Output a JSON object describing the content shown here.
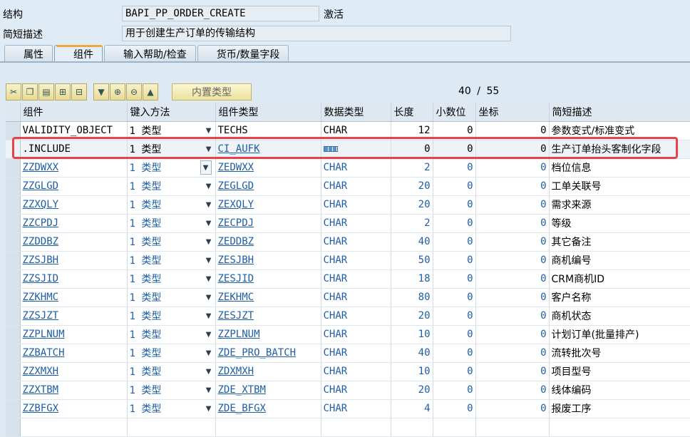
{
  "header": {
    "structure_label": "结构",
    "structure_value": "BAPI_PP_ORDER_CREATE",
    "status": "激活",
    "short_desc_label": "简短描述",
    "short_desc_value": "用于创建生产订单的传输结构"
  },
  "tabs": [
    {
      "label": "属性",
      "active": false
    },
    {
      "label": "组件",
      "active": true
    },
    {
      "label": "输入帮助/检查",
      "active": false
    },
    {
      "label": "货币/数量字段",
      "active": false
    }
  ],
  "toolbar": {
    "builtin_type_label": "内置类型",
    "counter_current": "40",
    "counter_sep": "/",
    "counter_total": "55",
    "icons": [
      "cut-icon",
      "copy-icon",
      "paste-icon",
      "insert-row-icon",
      "delete-row-icon",
      "filter-icon",
      "expand-icon",
      "collapse-icon",
      "sort-icon"
    ]
  },
  "columns": [
    "组件",
    "键入方法",
    "组件类型",
    "数据类型",
    "长度",
    "小数位",
    "坐标",
    "简短描述"
  ],
  "rows": [
    {
      "component": "VALIDITY_OBJECT",
      "method_num": "1",
      "method": "类型",
      "comp_type": "TECHS",
      "data_type": "CHAR",
      "length": "12",
      "decimals": "0",
      "coord": "0",
      "desc": "参数变式/标准变式",
      "link": false,
      "active": false
    },
    {
      "component": ".INCLUDE",
      "method_num": "1",
      "method": "类型",
      "comp_type": "CI_AUFK",
      "data_type": "",
      "length": "0",
      "decimals": "0",
      "coord": "0",
      "desc": "生产订单抬头客制化字段",
      "link": false,
      "active": true
    },
    {
      "component": "ZZDWXX",
      "method_num": "1",
      "method": "类型",
      "comp_type": "ZEDWXX",
      "data_type": "CHAR",
      "length": "2",
      "decimals": "0",
      "coord": "0",
      "desc": "档位信息",
      "link": true,
      "active": false
    },
    {
      "component": "ZZGLGD",
      "method_num": "1",
      "method": "类型",
      "comp_type": "ZEGLGD",
      "data_type": "CHAR",
      "length": "20",
      "decimals": "0",
      "coord": "0",
      "desc": "工单关联号",
      "link": true,
      "active": false
    },
    {
      "component": "ZZXQLY",
      "method_num": "1",
      "method": "类型",
      "comp_type": "ZEXQLY",
      "data_type": "CHAR",
      "length": "20",
      "decimals": "0",
      "coord": "0",
      "desc": "需求来源",
      "link": true,
      "active": false
    },
    {
      "component": "ZZCPDJ",
      "method_num": "1",
      "method": "类型",
      "comp_type": "ZECPDJ",
      "data_type": "CHAR",
      "length": "2",
      "decimals": "0",
      "coord": "0",
      "desc": "等级",
      "link": true,
      "active": false
    },
    {
      "component": "ZZDDBZ",
      "method_num": "1",
      "method": "类型",
      "comp_type": "ZEDDBZ",
      "data_type": "CHAR",
      "length": "40",
      "decimals": "0",
      "coord": "0",
      "desc": "其它备注",
      "link": true,
      "active": false
    },
    {
      "component": "ZZSJBH",
      "method_num": "1",
      "method": "类型",
      "comp_type": "ZESJBH",
      "data_type": "CHAR",
      "length": "50",
      "decimals": "0",
      "coord": "0",
      "desc": "商机编号",
      "link": true,
      "active": false
    },
    {
      "component": "ZZSJID",
      "method_num": "1",
      "method": "类型",
      "comp_type": "ZESJID",
      "data_type": "CHAR",
      "length": "18",
      "decimals": "0",
      "coord": "0",
      "desc": "CRM商机ID",
      "link": true,
      "active": false
    },
    {
      "component": "ZZKHMC",
      "method_num": "1",
      "method": "类型",
      "comp_type": "ZEKHMC",
      "data_type": "CHAR",
      "length": "80",
      "decimals": "0",
      "coord": "0",
      "desc": "客户名称",
      "link": true,
      "active": false
    },
    {
      "component": "ZZSJZT",
      "method_num": "1",
      "method": "类型",
      "comp_type": "ZESJZT",
      "data_type": "CHAR",
      "length": "20",
      "decimals": "0",
      "coord": "0",
      "desc": "商机状态",
      "link": true,
      "active": false
    },
    {
      "component": "ZZPLNUM",
      "method_num": "1",
      "method": "类型",
      "comp_type": "ZZPLNUM",
      "data_type": "CHAR",
      "length": "10",
      "decimals": "0",
      "coord": "0",
      "desc": "计划订单(批量排产)",
      "link": true,
      "active": false
    },
    {
      "component": "ZZBATCH",
      "method_num": "1",
      "method": "类型",
      "comp_type": "ZDE_PRO_BATCH",
      "data_type": "CHAR",
      "length": "40",
      "decimals": "0",
      "coord": "0",
      "desc": "流转批次号",
      "link": true,
      "active": false
    },
    {
      "component": "ZZXMXH",
      "method_num": "1",
      "method": "类型",
      "comp_type": "ZDXMXH",
      "data_type": "CHAR",
      "length": "10",
      "decimals": "0",
      "coord": "0",
      "desc": "项目型号",
      "link": true,
      "active": false
    },
    {
      "component": "ZZXTBM",
      "method_num": "1",
      "method": "类型",
      "comp_type": "ZDE_XTBM",
      "data_type": "CHAR",
      "length": "20",
      "decimals": "0",
      "coord": "0",
      "desc": "线体编码",
      "link": true,
      "active": false
    },
    {
      "component": "ZZBFGX",
      "method_num": "1",
      "method": "类型",
      "comp_type": "ZDE_BFGX",
      "data_type": "CHAR",
      "length": "4",
      "decimals": "0",
      "coord": "0",
      "desc": "报废工序",
      "link": true,
      "active": false
    }
  ]
}
